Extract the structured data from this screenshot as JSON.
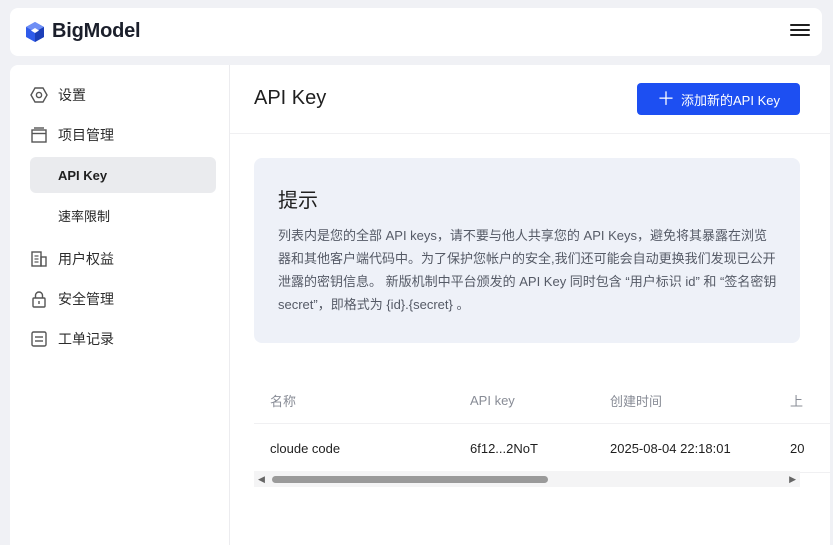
{
  "header": {
    "brand": "BigModel",
    "logo_icon": "bigmodel-logo-icon",
    "menu_icon": "hamburger-menu-icon"
  },
  "sidebar": {
    "items": [
      {
        "label": "设置",
        "icon": "settings-hexagon-icon"
      },
      {
        "label": "项目管理",
        "icon": "project-window-icon"
      },
      {
        "label": "API Key",
        "sub": true,
        "active": true
      },
      {
        "label": "速率限制",
        "sub": true,
        "active": false
      },
      {
        "label": "用户权益",
        "icon": "building-icon"
      },
      {
        "label": "安全管理",
        "icon": "lock-icon"
      },
      {
        "label": "工单记录",
        "icon": "ticket-icon"
      }
    ]
  },
  "main": {
    "title": "API Key",
    "add_button": "添加新的API Key",
    "tip": {
      "title": "提示",
      "body": "列表内是您的全部 API keys，请不要与他人共享您的 API Keys，避免将其暴露在浏览器和其他客户端代码中。为了保护您帐户的安全,我们还可能会自动更换我们发现已公开泄露的密钥信息。 新版机制中平台颁发的 API Key 同时包含 “用户标识 id” 和 “签名密钥 secret”，即格式为 {id}.{secret} 。"
    },
    "table": {
      "columns": [
        "名称",
        "API key",
        "创建时间",
        "上"
      ],
      "rows": [
        [
          "cloude code",
          "6f12...2NoT",
          "2025-08-04 22:18:01",
          "20"
        ]
      ]
    }
  },
  "colors": {
    "accent": "#1d4ff2",
    "tip_bg": "#eef1f8",
    "active_bg": "#eaebee"
  }
}
